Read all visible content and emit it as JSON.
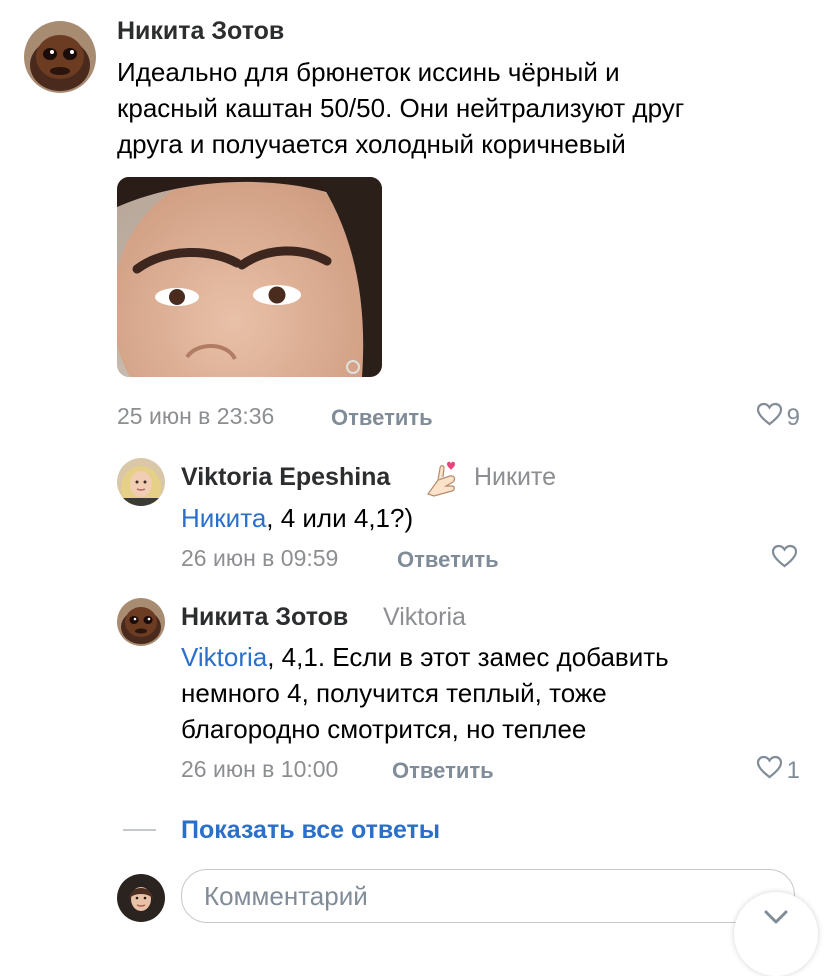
{
  "comment": {
    "author": "Никита Зотов",
    "text_lines": [
      "Идеально для брюнеток иссинь чёрный и",
      "красный каштан 50/50. Они нейтрализуют друг",
      "друга и получается холодный коричневый"
    ],
    "date": "25 июн в 23:36",
    "reply_label": "Ответить",
    "likes": "9"
  },
  "replies": [
    {
      "author": "Viktoria Epeshina",
      "to": "Никите",
      "mention": "Никита",
      "text": ", 4 или 4,1?)",
      "date": "26 июн в 09:59",
      "reply_label": "Ответить"
    },
    {
      "author": "Никита Зотов",
      "to": "Viktoria",
      "mention": "Viktoria",
      "text_lines": [
        ", 4,1. Если в этот замес добавить",
        "немного 4, получится теплый, тоже",
        "благородно смотрится, но теплее"
      ],
      "date": "26 июн в 10:00",
      "reply_label": "Ответить",
      "likes": "1"
    }
  ],
  "show_all_replies": "Показать все ответы",
  "comment_input": {
    "placeholder": "Комментарий"
  },
  "colors": {
    "link": "#2a6fc9",
    "meta": "#8c8e91",
    "icon": "#818c99"
  },
  "icons": [
    "heart-icon",
    "heart-emoji-hand-icon",
    "chevron-down-icon"
  ]
}
